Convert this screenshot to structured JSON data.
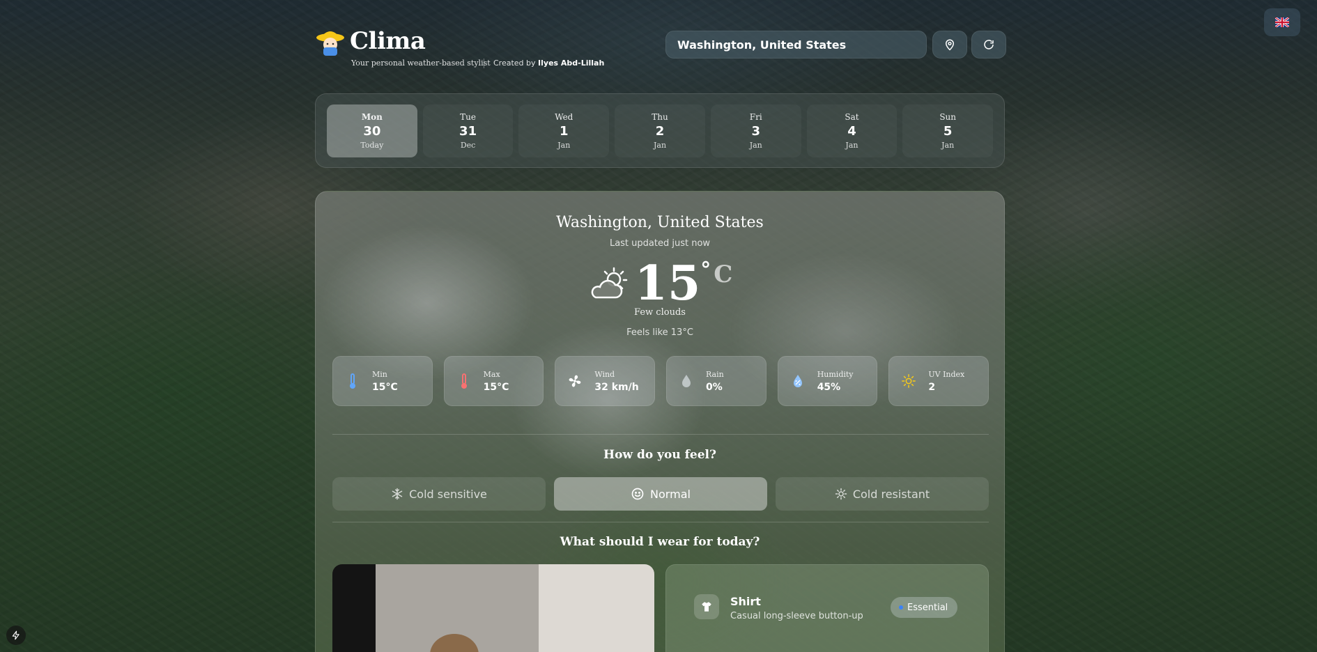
{
  "brand": {
    "name": "Clima",
    "tagline": "Your personal weather-based stylist",
    "credit_prefix": "Created by",
    "credit_author": "Ilyes Abd-Lillah"
  },
  "search": {
    "value": "Washington, United States"
  },
  "days": [
    {
      "name": "Mon",
      "date": "30",
      "sub": "Today"
    },
    {
      "name": "Tue",
      "date": "31",
      "sub": "Dec"
    },
    {
      "name": "Wed",
      "date": "1",
      "sub": "Jan"
    },
    {
      "name": "Thu",
      "date": "2",
      "sub": "Jan"
    },
    {
      "name": "Fri",
      "date": "3",
      "sub": "Jan"
    },
    {
      "name": "Sat",
      "date": "4",
      "sub": "Jan"
    },
    {
      "name": "Sun",
      "date": "5",
      "sub": "Jan"
    }
  ],
  "weather": {
    "location": "Washington, United States",
    "updated": "Last updated just now",
    "temp": "15",
    "deg": "°",
    "unit": "C",
    "condition": "Few clouds",
    "feels_like": "Feels like 13°C"
  },
  "stats": [
    {
      "label": "Min",
      "value": "15°C",
      "icon": "thermometer-cold-icon",
      "color": "#60a5fa"
    },
    {
      "label": "Max",
      "value": "15°C",
      "icon": "thermometer-hot-icon",
      "color": "#f87171"
    },
    {
      "label": "Wind",
      "value": "32 km/h",
      "icon": "fan-icon",
      "color": "#ffffff"
    },
    {
      "label": "Rain",
      "value": "0%",
      "icon": "raindrop-icon",
      "color": "#d1d5db"
    },
    {
      "label": "Humidity",
      "value": "45%",
      "icon": "humidity-icon",
      "color": "#93c5fd"
    },
    {
      "label": "UV Index",
      "value": "2",
      "icon": "sun-icon",
      "color": "#facc15"
    }
  ],
  "feel": {
    "title": "How do you feel?",
    "options": [
      "Cold sensitive",
      "Normal",
      "Cold resistant"
    ]
  },
  "wear": {
    "title": "What should I wear for today?",
    "item_name": "Shirt",
    "item_desc": "Casual long-sleeve button-up",
    "badge": "Essential"
  },
  "colors": {
    "accent_blue": "#3b82f6"
  }
}
